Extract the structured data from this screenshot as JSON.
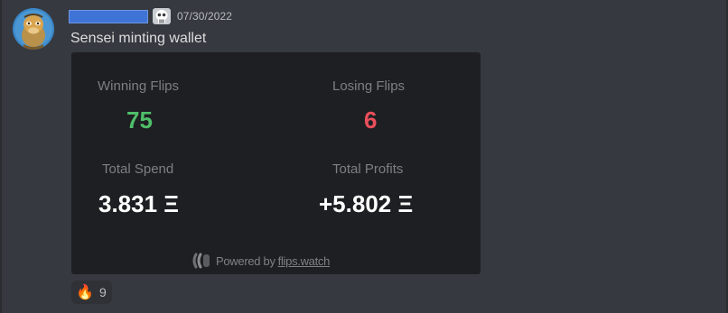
{
  "message": {
    "author_name_redacted": true,
    "timestamp": "07/30/2022",
    "text": "Sensei minting wallet",
    "avatar_icon": "ape-avatar-icon",
    "role_icon": "skull-badge-icon"
  },
  "embed": {
    "stats": [
      {
        "label": "Winning Flips",
        "value": "75",
        "color": "#4fbf6a"
      },
      {
        "label": "Losing Flips",
        "value": "6",
        "color": "#ea4f5b"
      },
      {
        "label": "Total Spend",
        "value": "3.831 Ξ",
        "color": "#ffffff"
      },
      {
        "label": "Total Profits",
        "value": "+5.802 Ξ",
        "color": "#ffffff"
      }
    ],
    "footer": {
      "powered_by": "Powered by",
      "site": "flips.watch",
      "logo_icon": "flips-watch-logo-icon"
    }
  },
  "reaction": {
    "emoji": "🔥",
    "emoji_icon": "fire-emoji-icon",
    "count": "9"
  },
  "colors": {
    "background": "#36393f",
    "embed_background": "#1e1f22",
    "username_bar": "#3f73d6",
    "win": "#4fbf6a",
    "lose": "#ea4f5b"
  }
}
